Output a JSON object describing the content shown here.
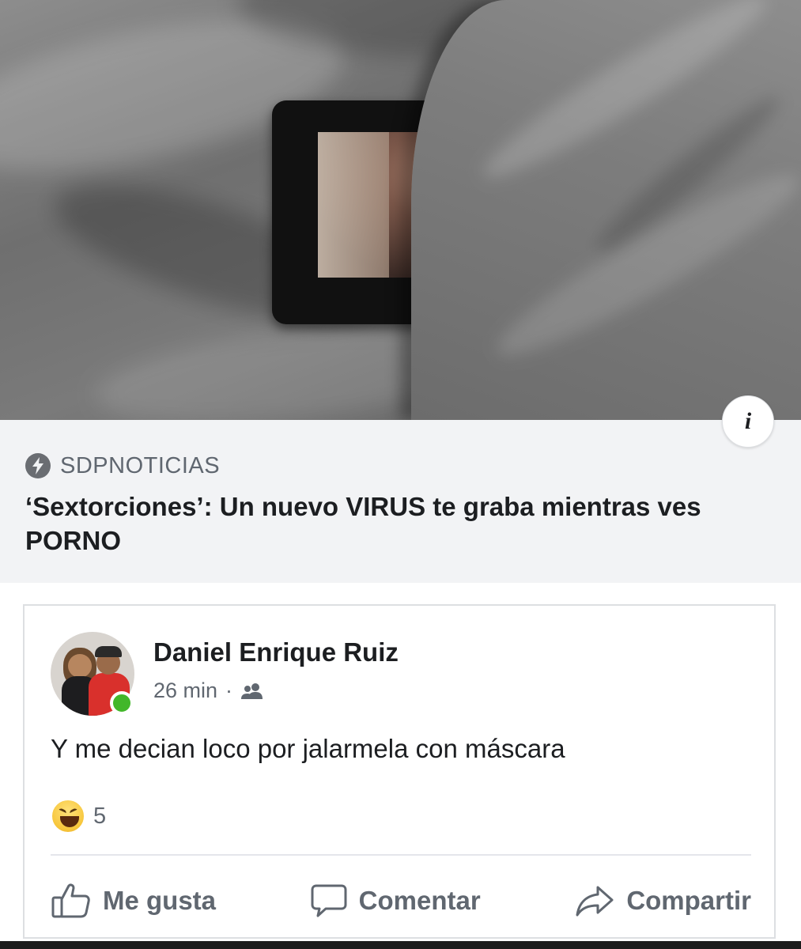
{
  "link_preview": {
    "source": "SDPNOTICIAS",
    "headline": "‘Sextorciones’: Un nuevo VIRUS te graba mientras ves PORNO",
    "info_icon": "info-icon",
    "source_icon": "bolt-icon"
  },
  "comment": {
    "author": "Daniel Enrique Ruiz",
    "time": "26 min",
    "separator": "·",
    "privacy_icon": "friends-icon",
    "online": true,
    "text": "Y me decian loco por jalarmela con máscara",
    "reaction": {
      "icon": "haha-icon",
      "count": "5"
    },
    "actions": {
      "like": "Me gusta",
      "comment": "Comentar",
      "share": "Compartir"
    }
  },
  "colors": {
    "caption_background": "#f2f3f5",
    "secondary_text": "#606770",
    "online_green": "#42b72a",
    "primary_text": "#1c1e21"
  }
}
